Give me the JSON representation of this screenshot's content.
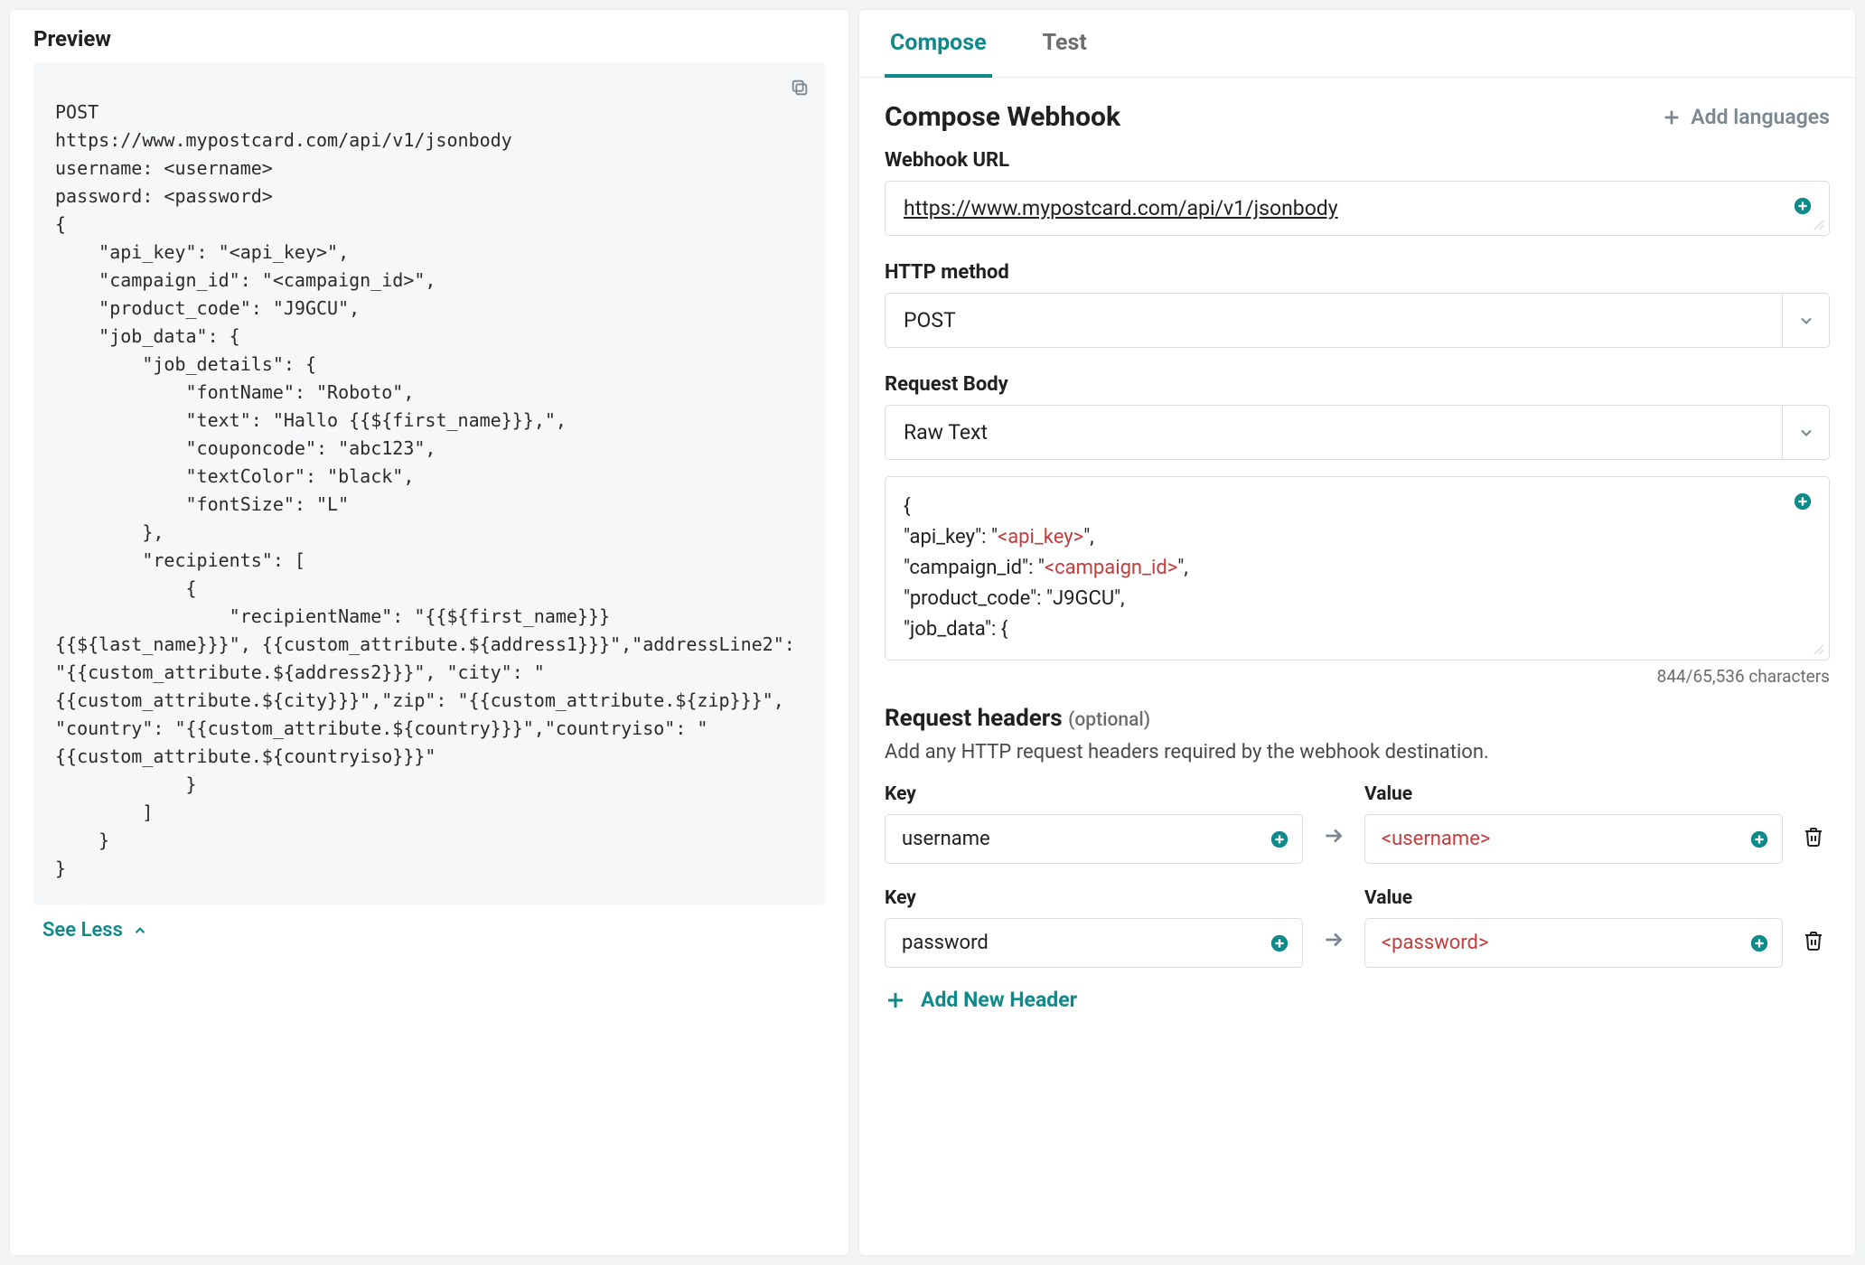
{
  "preview": {
    "title": "Preview",
    "code": "POST\nhttps://www.mypostcard.com/api/v1/jsonbody\nusername: <username>\npassword: <password>\n{\n    \"api_key\": \"<api_key>\",\n    \"campaign_id\": \"<campaign_id>\",\n    \"product_code\": \"J9GCU\",\n    \"job_data\": {\n        \"job_details\": {\n            \"fontName\": \"Roboto\",\n            \"text\": \"Hallo {{${first_name}}},\",\n            \"couponcode\": \"abc123\",\n            \"textColor\": \"black\",\n            \"fontSize\": \"L\"\n        },\n        \"recipients\": [\n            {\n                \"recipientName\": \"{{${first_name}}} {{${last_name}}}\", {{custom_attribute.${address1}}}\",\"addressLine2\": \"{{custom_attribute.${address2}}}\", \"city\": \"{{custom_attribute.${city}}}\",\"zip\": \"{{custom_attribute.${zip}}}\", \"country\": \"{{custom_attribute.${country}}}\",\"countryiso\": \"{{custom_attribute.${countryiso}}}\"\n            }\n        ]\n    }\n}",
    "see_less": "See Less"
  },
  "tabs": {
    "compose": "Compose",
    "test": "Test"
  },
  "compose": {
    "title": "Compose Webhook",
    "add_languages": "Add languages",
    "webhook_url_label": "Webhook URL",
    "webhook_url_value": "https://www.mypostcard.com/api/v1/jsonbody",
    "http_method_label": "HTTP method",
    "http_method_value": "POST",
    "request_body_label": "Request Body",
    "request_body_type": "Raw Text",
    "request_body_lines": [
      "{",
      "    \"api_key\": \"<api_key>\",",
      "    \"campaign_id\": \"<campaign_id>\",",
      "    \"product_code\": \"J9GCU\",",
      "    \"job_data\": {"
    ],
    "char_count": "844/65,536 characters",
    "headers_title": "Request headers",
    "headers_optional": "(optional)",
    "headers_desc": "Add any HTTP request headers required by the webhook destination.",
    "key_label": "Key",
    "value_label": "Value",
    "headers": [
      {
        "key": "username",
        "value": "<username>"
      },
      {
        "key": "password",
        "value": "<password>"
      }
    ],
    "add_header": "Add New Header"
  }
}
